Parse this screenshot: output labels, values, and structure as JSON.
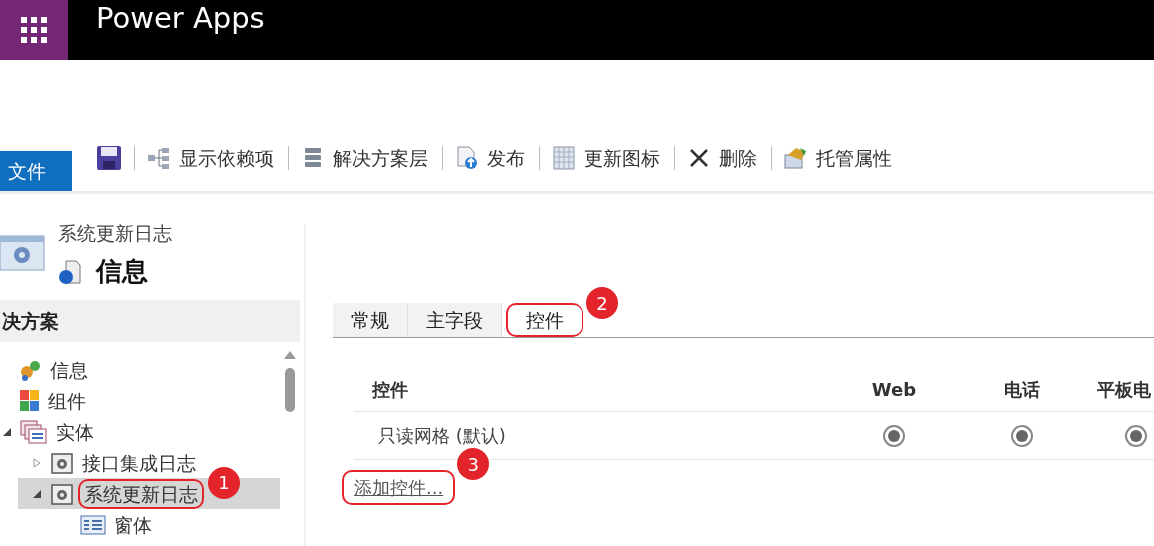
{
  "app_bar": {
    "title": "Power Apps"
  },
  "ribbon": {
    "file_tab": "文件",
    "items": [
      {
        "label": "显示依赖项"
      },
      {
        "label": "解决方案层"
      },
      {
        "label": "发布"
      },
      {
        "label": "更新图标"
      },
      {
        "label": "删除"
      },
      {
        "label": "托管属性"
      }
    ]
  },
  "entity_header": {
    "entity": "系统更新日志",
    "title": "信息"
  },
  "sidebar": {
    "heading": "决方案",
    "tree": [
      {
        "label": "信息",
        "kind": "info",
        "selected": false
      },
      {
        "label": "组件",
        "kind": "components",
        "selected": false
      },
      {
        "label": "实体",
        "kind": "entities",
        "expanded": true,
        "selected": false,
        "children": [
          {
            "label": "接口集成日志",
            "kind": "entity",
            "expanded": false,
            "selected": false
          },
          {
            "label": "系统更新日志",
            "kind": "entity",
            "expanded": true,
            "selected": true,
            "callout": "1",
            "children": [
              {
                "label": "窗体",
                "kind": "forms",
                "selected": false
              }
            ]
          }
        ]
      }
    ]
  },
  "tabs": [
    {
      "label": "常规",
      "selected": false
    },
    {
      "label": "主字段",
      "selected": false
    },
    {
      "label": "控件",
      "selected": true,
      "callout": "2"
    }
  ],
  "controls_table": {
    "columns": [
      "控件",
      "Web",
      "电话",
      "平板电"
    ],
    "rows": [
      {
        "name": "只读网格 (默认)",
        "cells": [
          {
            "selected": true
          },
          {
            "selected": true
          },
          {
            "selected": true
          }
        ]
      }
    ],
    "add_link": {
      "label": "添加控件...",
      "callout": "3"
    }
  }
}
